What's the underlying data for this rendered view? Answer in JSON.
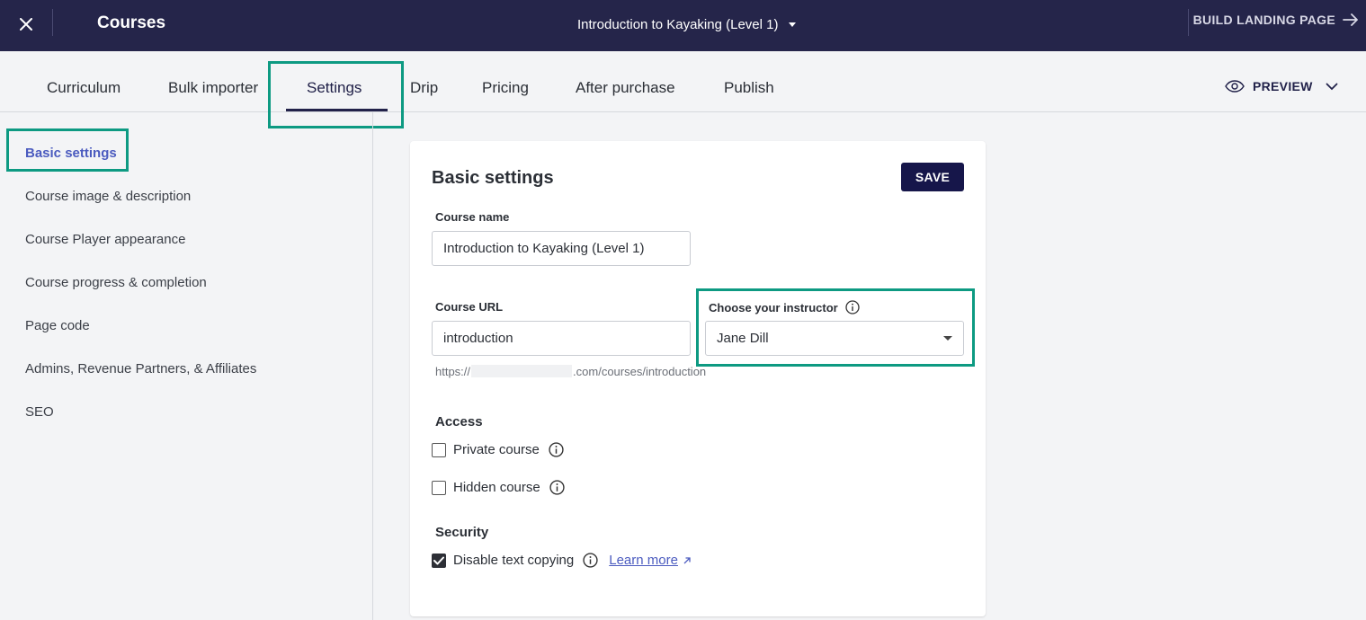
{
  "topbar": {
    "title": "Courses",
    "course_selector": "Introduction to Kayaking (Level 1)",
    "build_landing_page": "BUILD LANDING PAGE"
  },
  "tabs": [
    {
      "label": "Curriculum"
    },
    {
      "label": "Bulk importer"
    },
    {
      "label": "Settings",
      "active": true
    },
    {
      "label": "Drip"
    },
    {
      "label": "Pricing"
    },
    {
      "label": "After purchase"
    },
    {
      "label": "Publish"
    }
  ],
  "preview_label": "PREVIEW",
  "sidebar": {
    "items": [
      {
        "label": "Basic settings",
        "active": true
      },
      {
        "label": "Course image & description"
      },
      {
        "label": "Course Player appearance"
      },
      {
        "label": "Course progress & completion"
      },
      {
        "label": "Page code"
      },
      {
        "label": "Admins, Revenue Partners, & Affiliates"
      },
      {
        "label": "SEO"
      }
    ]
  },
  "form": {
    "title": "Basic settings",
    "save_label": "SAVE",
    "course_name_label": "Course name",
    "course_name_value": "Introduction to Kayaking (Level 1)",
    "course_url_label": "Course URL",
    "course_url_value": "introduction",
    "url_prefix": "https://",
    "url_suffix": ".com/courses/introduction",
    "instructor_label": "Choose your instructor",
    "instructor_value": "Jane Dill",
    "access_heading": "Access",
    "private_course_label": "Private course",
    "private_course_checked": false,
    "hidden_course_label": "Hidden course",
    "hidden_course_checked": false,
    "security_heading": "Security",
    "disable_copy_label": "Disable text copying",
    "disable_copy_checked": true,
    "learn_more_label": "Learn more"
  },
  "colors": {
    "topbar_bg": "#25254a",
    "highlight": "#0d9a82",
    "accent_link": "#4b5bbf",
    "save_button_bg": "#16164a"
  }
}
